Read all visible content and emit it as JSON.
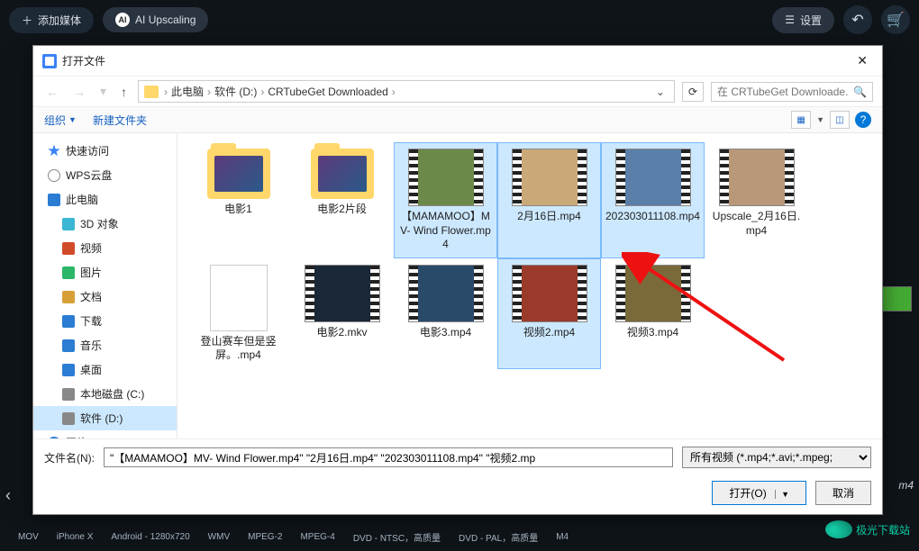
{
  "topbar": {
    "add_media": "添加媒体",
    "ai_upscaling": "AI Upscaling",
    "settings": "设置"
  },
  "dialog": {
    "title": "打开文件",
    "breadcrumb": [
      "此电脑",
      "软件 (D:)",
      "CRTubeGet Downloaded"
    ],
    "search_placeholder": "在 CRTubeGet Downloade...",
    "toolbar": {
      "organize": "组织",
      "new_folder": "新建文件夹"
    },
    "tree": [
      {
        "label": "快速访问",
        "icon": "star"
      },
      {
        "label": "WPS云盘",
        "icon": "cloud"
      },
      {
        "label": "此电脑",
        "icon": "pc"
      },
      {
        "label": "3D 对象",
        "icon": "3d",
        "indent": true
      },
      {
        "label": "视频",
        "icon": "video",
        "indent": true
      },
      {
        "label": "图片",
        "icon": "pic",
        "indent": true
      },
      {
        "label": "文档",
        "icon": "doc",
        "indent": true
      },
      {
        "label": "下载",
        "icon": "down",
        "indent": true
      },
      {
        "label": "音乐",
        "icon": "music",
        "indent": true
      },
      {
        "label": "桌面",
        "icon": "desk",
        "indent": true
      },
      {
        "label": "本地磁盘 (C:)",
        "icon": "disk",
        "indent": true
      },
      {
        "label": "软件 (D:)",
        "icon": "disk",
        "indent": true,
        "selected": true
      },
      {
        "label": "网络",
        "icon": "net"
      }
    ],
    "files": [
      {
        "name": "电影1",
        "type": "folder"
      },
      {
        "name": "电影2片段",
        "type": "folder"
      },
      {
        "name": "【MAMAMOO】MV- Wind Flower.mp4",
        "type": "video",
        "selected": true,
        "bg": "#6b8a4a"
      },
      {
        "name": "2月16日.mp4",
        "type": "video",
        "selected": true,
        "bg": "#caa978"
      },
      {
        "name": "202303011108.mp4",
        "type": "video",
        "selected": true,
        "bg": "#5a7fa8"
      },
      {
        "name": "Upscale_2月16日.mp4",
        "type": "video",
        "bg": "#b89878"
      },
      {
        "name": "登山赛车但是竖屏。.mp4",
        "type": "phone"
      },
      {
        "name": "电影2.mkv",
        "type": "video",
        "bg": "#1a2838"
      },
      {
        "name": "电影3.mp4",
        "type": "video",
        "bg": "#2a4a6a"
      },
      {
        "name": "视频2.mp4",
        "type": "video",
        "selected": true,
        "bg": "#9a3a2a"
      },
      {
        "name": "视频3.mp4",
        "type": "video",
        "bg": "#7a6a3a"
      }
    ],
    "filename_label": "文件名(N):",
    "filename_value": "\"【MAMAMOO】MV- Wind Flower.mp4\" \"2月16日.mp4\" \"202303011108.mp4\" \"视频2.mp",
    "filter": "所有视频 (*.mp4;*.avi;*.mpeg;",
    "open_btn": "打开(O)",
    "cancel_btn": "取消"
  },
  "bottomstrip": [
    "MOV",
    "iPhone X",
    "Android - 1280x720",
    "WMV",
    "MPEG-2",
    "MPEG-4",
    "DVD - NTSC，高质量",
    "DVD - PAL，高质量",
    "M4"
  ],
  "watermark": "极光下载站",
  "m4v": "m4"
}
